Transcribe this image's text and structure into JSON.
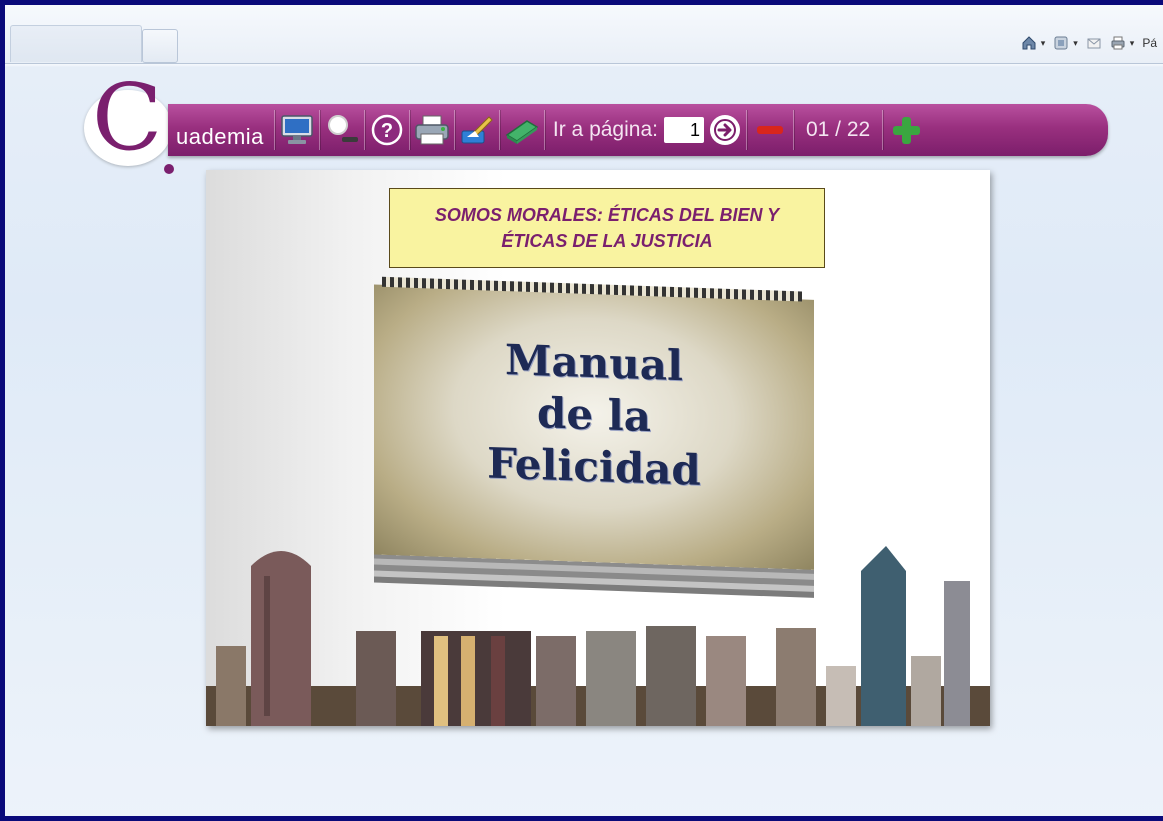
{
  "browser": {
    "tools": [
      {
        "icon": "home-icon",
        "caret": "▾"
      },
      {
        "icon": "feeds-icon",
        "caret": "▾"
      },
      {
        "icon": "mail-icon",
        "caret": ""
      },
      {
        "icon": "print-icon",
        "caret": "▾"
      },
      {
        "icon": "page-menu-icon",
        "label": "Pá"
      }
    ]
  },
  "toolbar": {
    "brand": "uademia",
    "goto_label": "Ir a página:",
    "page_value": "1",
    "counter": "01 / 22",
    "buttons": [
      "monitor-icon",
      "search-icon",
      "help-icon",
      "print-icon",
      "clean-icon",
      "eraser-icon"
    ],
    "colors": {
      "bar": "#99307f",
      "logo": "#7a1f6e",
      "minus": "#d9261c",
      "plus": "#3aa640"
    }
  },
  "page": {
    "title_line1": "SOMOS MORALES: ÉTICAS DEL BIEN Y",
    "title_line2": "ÉTICAS DE LA JUSTICIA",
    "book_line1": "Manual",
    "book_line2": "de la",
    "book_line3": "Felicidad"
  }
}
